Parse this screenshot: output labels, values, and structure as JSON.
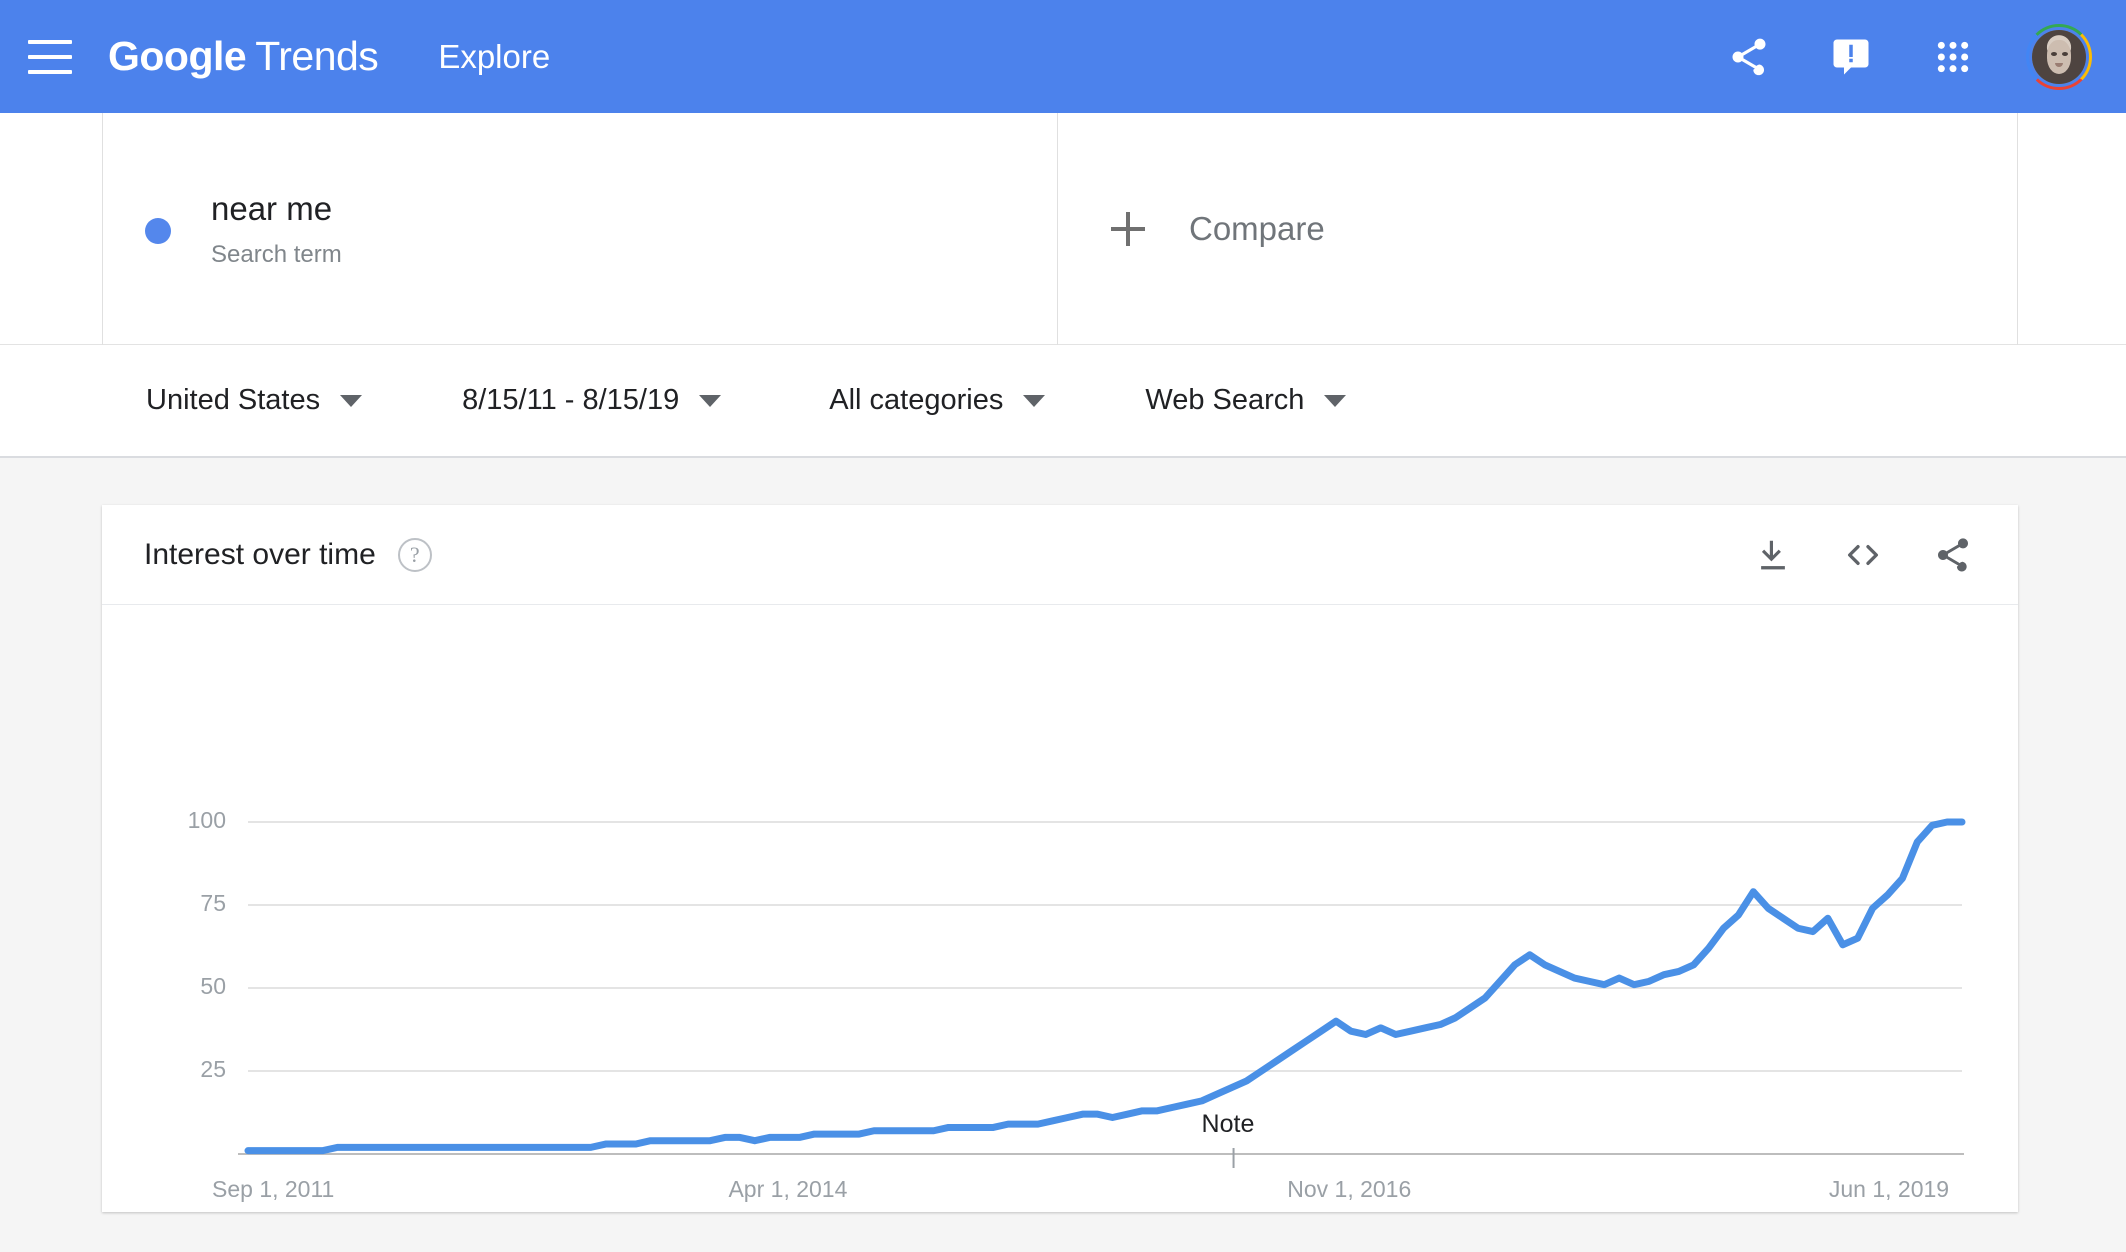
{
  "header": {
    "menu_icon": "hamburger-menu-icon",
    "brand_bold": "Google",
    "brand_light": "Trends",
    "nav_explore": "Explore",
    "share_icon": "share-icon",
    "feedback_icon": "feedback-icon",
    "apps_icon": "apps-grid-icon",
    "avatar_icon": "user-avatar",
    "background_color": "#4c82ec"
  },
  "search_term": {
    "dot_color": "#5487ec",
    "title": "near me",
    "subtitle": "Search term",
    "compare_plus_icon": "plus-icon",
    "compare_label": "Compare"
  },
  "filters": [
    {
      "label": "United States",
      "caret_icon": "caret-down-icon"
    },
    {
      "label": "8/15/11 - 8/15/19",
      "caret_icon": "caret-down-icon"
    },
    {
      "label": "All categories",
      "caret_icon": "caret-down-icon"
    },
    {
      "label": "Web Search",
      "caret_icon": "caret-down-icon"
    }
  ],
  "card": {
    "title": "Interest over time",
    "help_icon": "help-circle-icon",
    "help_glyph": "?",
    "download_icon": "download-icon",
    "embed_icon": "embed-code-icon",
    "share_icon": "share-icon"
  },
  "chart_data": {
    "type": "line",
    "title": "Interest over time",
    "xlabel": "",
    "ylabel": "",
    "ylim": [
      0,
      100
    ],
    "yticks": [
      100,
      75,
      50,
      25
    ],
    "xticks": [
      "Sep 1, 2011",
      "Apr 1, 2014",
      "Nov 1, 2016",
      "Jun 1, 2019"
    ],
    "xtick_positions": [
      0,
      0.327,
      0.653,
      0.976
    ],
    "grid": true,
    "legend": "none",
    "line_color": "#4a90e6",
    "line_width": 7,
    "annotations": [
      {
        "label": "Note",
        "x_fraction": 0.575
      }
    ],
    "x_start": "2011-09-01",
    "x_end": "2019-08-01",
    "x_interval": "monthly",
    "series": [
      {
        "name": "near me",
        "color": "#4a90e6",
        "values": [
          1,
          1,
          1,
          1,
          1,
          1,
          2,
          2,
          2,
          2,
          2,
          2,
          2,
          2,
          2,
          2,
          2,
          2,
          2,
          2,
          2,
          2,
          2,
          2,
          3,
          3,
          3,
          4,
          4,
          4,
          4,
          4,
          5,
          5,
          4,
          5,
          5,
          5,
          6,
          6,
          6,
          6,
          7,
          7,
          7,
          7,
          7,
          8,
          8,
          8,
          8,
          9,
          9,
          9,
          10,
          11,
          12,
          12,
          11,
          12,
          13,
          13,
          14,
          15,
          16,
          18,
          20,
          22,
          25,
          28,
          31,
          34,
          37,
          40,
          37,
          36,
          38,
          36,
          37,
          38,
          39,
          41,
          44,
          47,
          52,
          57,
          60,
          57,
          55,
          53,
          52,
          51,
          53,
          51,
          52,
          54,
          55,
          57,
          62,
          68,
          72,
          79,
          74,
          71,
          68,
          67,
          71,
          63,
          65,
          74,
          78,
          83,
          94,
          99,
          100,
          100
        ]
      }
    ]
  }
}
